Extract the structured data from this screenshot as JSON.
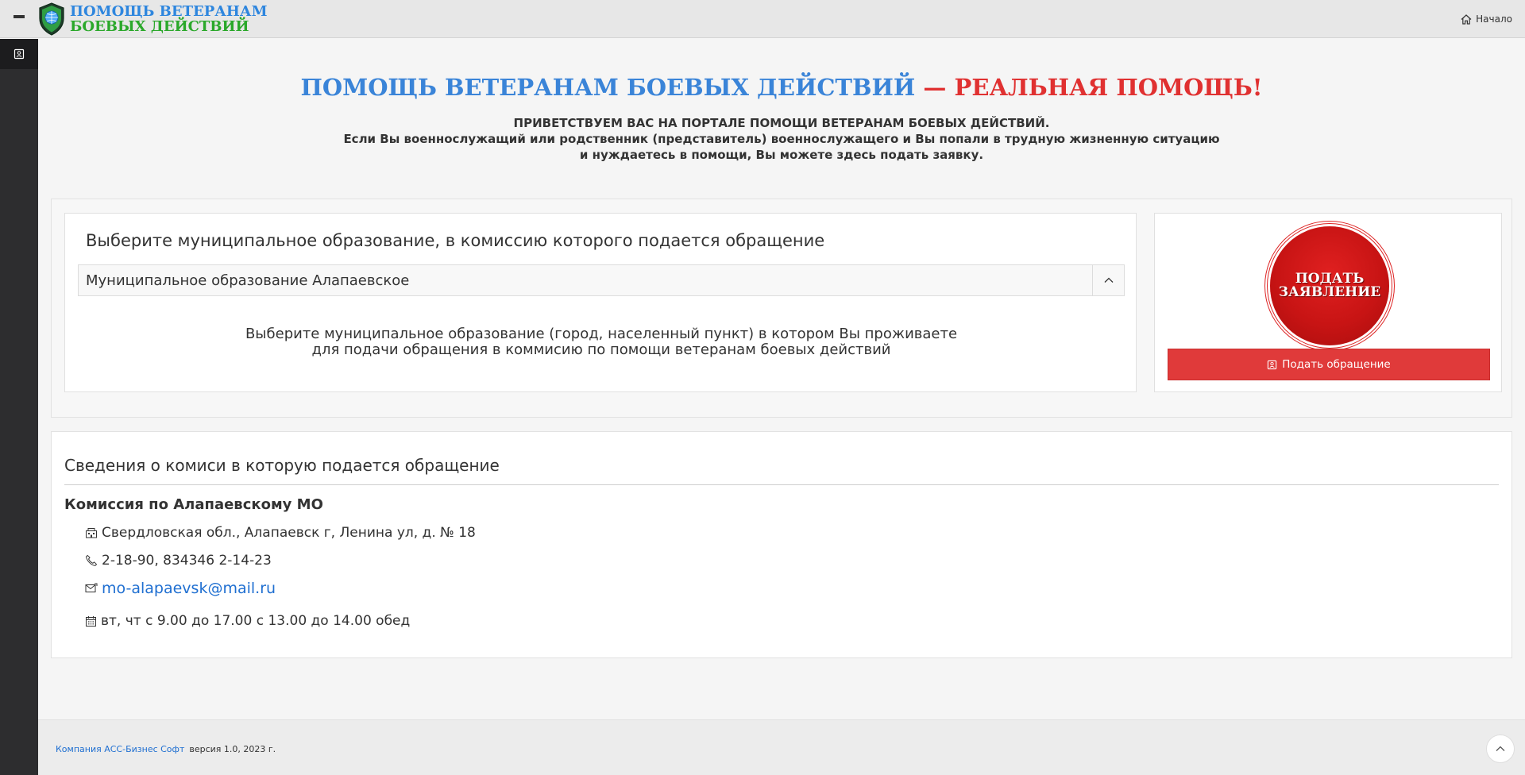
{
  "header": {
    "logo_line1": "ПОМОЩЬ ВЕТЕРАНАМ",
    "logo_line2": "БОЕВЫХ ДЕЙСТВИЙ",
    "home_label": "Начало"
  },
  "hero": {
    "title_blue": "ПОМОЩЬ ВЕТЕРАНАМ БОЕВЫХ ДЕЙСТВИЙ",
    "title_dash": " — ",
    "title_red": "РЕАЛЬНАЯ ПОМОЩЬ!",
    "sub_line1": "ПРИВЕТСТВУЕМ ВАС НА ПОРТАЛЕ ПОМОЩИ ВЕТЕРАНАМ БОЕВЫХ ДЕЙСТВИЙ.",
    "sub_line2": "Если Вы военнослужащий или родственник (представитель) военнослужащего и Вы попали в трудную жизненную ситуацию",
    "sub_line3": "и нуждаетесь в помощи, Вы можете здесь подать заявку."
  },
  "municipality": {
    "title": "Выберите муниципальное образование, в комиссию которого подается обращение",
    "selected": "Муниципальное образование Алапаевское",
    "hint_line1": "Выберите муниципальное образование (город, населенный пункт) в котором Вы проживаете",
    "hint_line2": "для подачи обращения в коммисию по помощи ветеранам боевых действий"
  },
  "apply": {
    "badge_line1": "ПОДАТЬ",
    "badge_line2": "ЗАЯВЛЕНИЕ",
    "button_label": "Подать обращение"
  },
  "commission": {
    "section_title": "Сведения о комиси в которую подается обращение",
    "name": "Комиссия по Алапаевскому МО",
    "address": "Свердловская обл., Алапаевск г, Ленина ул, д. № 18",
    "phone": "2-18-90, 834346 2-14-23",
    "email": "mo-alapaevsk@mail.ru",
    "schedule": "вт, чт с 9.00 до 17.00 с 13.00 до 14.00 обед"
  },
  "footer": {
    "company": "Компания АСС-Бизнес Софт",
    "version": "версия 1.0, 2023 г."
  },
  "colors": {
    "accent_blue": "#3a84d8",
    "accent_red": "#e03131",
    "logo_green": "#2aa82a",
    "button_red": "#e03a3a",
    "sidebar": "#2d2d2f"
  },
  "icons": [
    "menu-icon",
    "shield-logo-icon",
    "home-icon",
    "form-icon",
    "chevron-up-icon",
    "building-icon",
    "phone-icon",
    "mail-icon",
    "calendar-icon"
  ]
}
